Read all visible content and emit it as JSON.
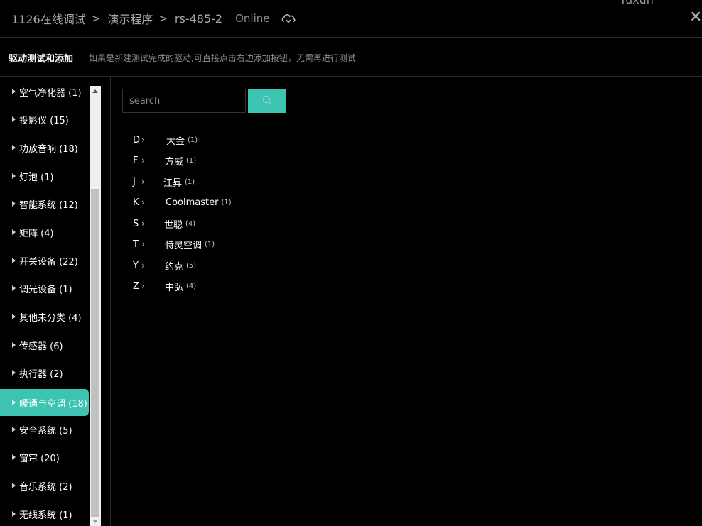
{
  "header": {
    "breadcrumb": [
      "1126在线调试",
      "演示程序",
      "rs-485-2"
    ],
    "status": "Online",
    "user_partial": "Yuxun"
  },
  "subheader": {
    "title": "驱动测试和添加",
    "hint": "如果是新建测试完成的驱动,可直接点击右边添加按钮，无需再进行测试"
  },
  "sidebar": {
    "items": [
      {
        "label": "空气净化器 (1)"
      },
      {
        "label": "投影仪 (15)"
      },
      {
        "label": "功放音响 (18)"
      },
      {
        "label": "灯泡 (1)"
      },
      {
        "label": "智能系统 (12)"
      },
      {
        "label": "矩阵 (4)"
      },
      {
        "label": "开关设备 (22)"
      },
      {
        "label": "调光设备 (1)"
      },
      {
        "label": "其他未分类 (4)"
      },
      {
        "label": "传感器 (6)"
      },
      {
        "label": "执行器 (2)"
      },
      {
        "label": "暖通与空调 (18)",
        "active": true
      },
      {
        "label": "安全系统 (5)"
      },
      {
        "label": "窗帘 (20)"
      },
      {
        "label": "音乐系统 (2)"
      },
      {
        "label": "无线系统 (1)"
      }
    ]
  },
  "search": {
    "placeholder": "search",
    "value": ""
  },
  "brands": [
    {
      "letter": "D",
      "name": "大金",
      "count": "(1)"
    },
    {
      "letter": "F",
      "name": "方威",
      "count": "(1)"
    },
    {
      "letter": "J",
      "name": "江昇",
      "count": "(1)"
    },
    {
      "letter": "K",
      "name": "Coolmaster",
      "count": "(1)"
    },
    {
      "letter": "S",
      "name": "世聪",
      "count": "(4)"
    },
    {
      "letter": "T",
      "name": "特灵空调",
      "count": "(1)"
    },
    {
      "letter": "Y",
      "name": "约克",
      "count": "(5)"
    },
    {
      "letter": "Z",
      "name": "中弘",
      "count": "(4)"
    }
  ],
  "colors": {
    "accent": "#3cc3b2",
    "background": "#000000"
  }
}
